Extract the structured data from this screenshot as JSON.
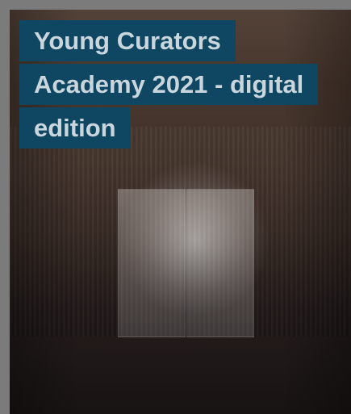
{
  "card": {
    "title": "Young Curators Academy 2021 - digital edition"
  }
}
